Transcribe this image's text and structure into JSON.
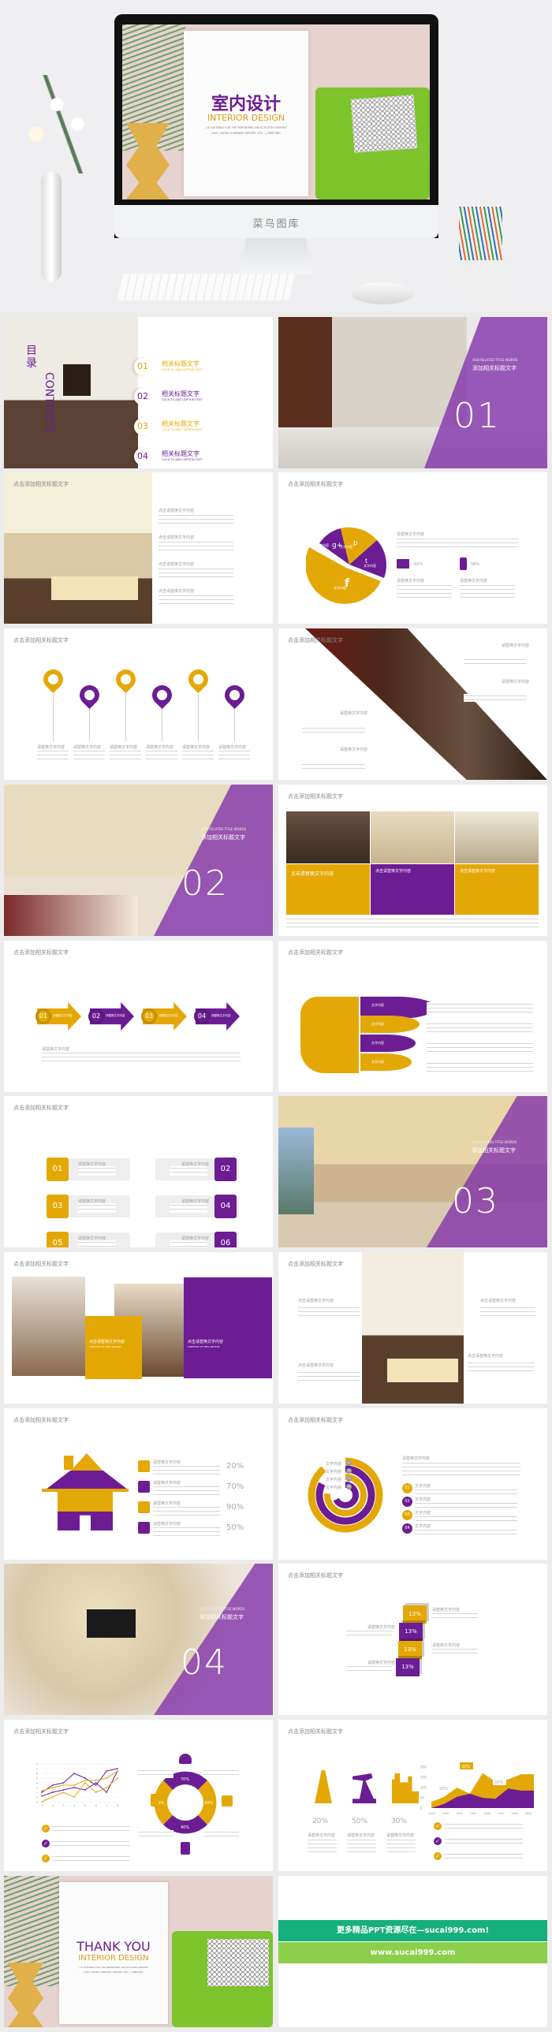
{
  "hero": {
    "title_cn": "室内设计",
    "title_en": "INTERIOR DESIGN",
    "sub1": "| IS SUITABLE FOR THE REPORTING ON ACTIVITIES REPORT",
    "sub2": "| BIO | WORK SUMMARY REPORT, ETC. | | MEETING",
    "brand": "菜鸟图库"
  },
  "common": {
    "slide_title": "点击添加相关标题文字",
    "section_en": "ADD RELATED TITLE WORDS",
    "section_cn": "添加相关标题文字",
    "replace": "请替换文字内容",
    "click_replace": "点击请替换文字内容",
    "text_content": "文字内容",
    "subtitle": "SUBTITLE OF THIS ARTICLE"
  },
  "contents": {
    "label_cn": "目录",
    "label_en": "CONTENTS",
    "items": [
      {
        "num": "01",
        "title": "相关标题文字",
        "caption": "CLICK TO ADD CAPTION TEXT"
      },
      {
        "num": "02",
        "title": "相关标题文字",
        "caption": "CLICK TO ADD CAPTION TEXT"
      },
      {
        "num": "03",
        "title": "相关标题文字",
        "caption": "CLICK TO ADD CAPTION TEXT"
      },
      {
        "num": "04",
        "title": "相关标题文字",
        "caption": "CLICK TO ADD CAPTION TEXT"
      }
    ]
  },
  "sections": [
    "01",
    "02",
    "03",
    "04"
  ],
  "pie": {
    "stat_monitor": "42%",
    "stat_phone": "58%",
    "icons": [
      "google-plus-icon",
      "pinterest-icon",
      "twitter-icon",
      "facebook-icon"
    ]
  },
  "arrows": [
    "01",
    "02",
    "03",
    "04"
  ],
  "boxes": [
    "01",
    "02",
    "03",
    "04",
    "05",
    "06"
  ],
  "house": {
    "percents": [
      "20%",
      "70%",
      "90%",
      "50%"
    ],
    "icons": [
      "user-icon",
      "key-icon",
      "globe-icon",
      "trophy-icon"
    ]
  },
  "rings": [
    "01",
    "02",
    "03",
    "04"
  ],
  "cubes": [
    "13%",
    "13%",
    "13%",
    "13%"
  ],
  "donut": [
    "70%",
    "30%",
    "40%",
    "50%"
  ],
  "industry": [
    "20%",
    "50%",
    "30%"
  ],
  "thanks": {
    "title": "THANK YOU",
    "en": "INTERIOR DESIGN"
  },
  "ad": {
    "line1": "更多精品PPT资源尽在—sucai999.com!",
    "line2": "www.sucai999.com"
  },
  "colors": {
    "purple": "#6c1d93",
    "gold": "#e4a806",
    "green1": "#16b07c",
    "green2": "#8bcf4a"
  },
  "chart_data": [
    {
      "type": "line",
      "x": [
        1,
        2,
        3,
        4,
        5,
        6,
        7,
        8
      ],
      "ylim": [
        0,
        8
      ],
      "yticks": [
        "0",
        "1",
        "2",
        "3",
        "4",
        "5",
        "6",
        "7",
        "8"
      ],
      "xticks": [
        "1",
        "2",
        "3",
        "4",
        "5",
        "6",
        "7",
        "8"
      ],
      "series": [
        {
          "color": "#6c1d93",
          "values": [
            2,
            3.5,
            4,
            6,
            5,
            3.5,
            6.5,
            7
          ]
        },
        {
          "color": "#6c1d93",
          "values": [
            1.2,
            2,
            2.5,
            3,
            2.5,
            4,
            2,
            6.5
          ]
        },
        {
          "color": "#e4a806",
          "values": [
            2.3,
            3,
            3.5,
            3.5,
            4.5,
            4.5,
            5,
            6.5
          ]
        },
        {
          "color": "#e4a806",
          "values": [
            0,
            1,
            2,
            1,
            4,
            2,
            3,
            5
          ]
        }
      ]
    },
    {
      "type": "area",
      "ylim": [
        0,
        200
      ],
      "yticks": [
        "200",
        "150",
        "100",
        "50",
        "0"
      ],
      "xticks": [
        "1900",
        "1900",
        "1900",
        "1900",
        "1900",
        "1900",
        "1900",
        "1900"
      ],
      "series": [
        {
          "color": "#e4a806",
          "values": [
            30,
            55,
            100,
            70,
            170,
            130,
            140,
            165,
            165
          ]
        },
        {
          "color": "#6c1d93",
          "values": [
            0,
            20,
            55,
            70,
            50,
            45,
            95,
            85,
            85
          ]
        }
      ],
      "labels": [
        "20%",
        "30%",
        "50%"
      ]
    }
  ]
}
